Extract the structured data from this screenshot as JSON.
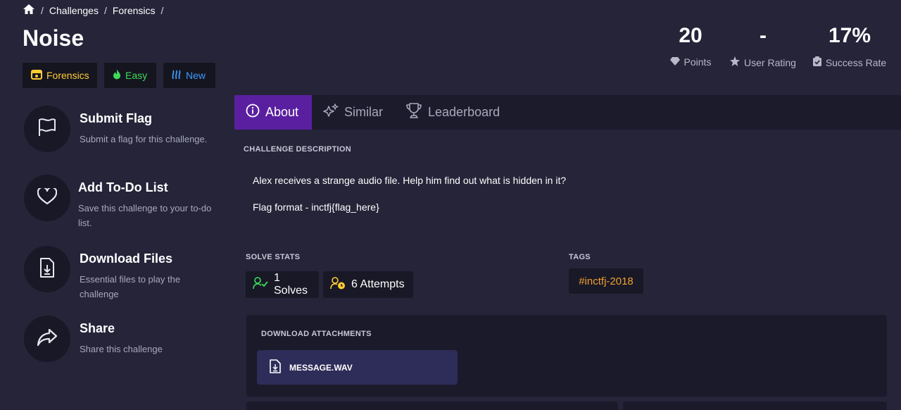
{
  "breadcrumb": {
    "items": [
      "Challenges",
      "Forensics"
    ],
    "separator": "/"
  },
  "challenge": {
    "title": "Noise"
  },
  "badges": {
    "category": "Forensics",
    "difficulty": "Easy",
    "status": "New"
  },
  "stats": {
    "points": {
      "value": "20",
      "label": "Points"
    },
    "rating": {
      "value": "-",
      "label": "User Rating"
    },
    "success": {
      "value": "17%",
      "label": "Success Rate"
    }
  },
  "sidebar": {
    "submit": {
      "title": "Submit Flag",
      "subtitle": "Submit a flag for this challenge."
    },
    "todo": {
      "title": "Add To-Do List",
      "subtitle": "Save this challenge to your to-do list."
    },
    "download": {
      "title": "Download Files",
      "subtitle": "Essential files to play the challenge"
    },
    "share": {
      "title": "Share",
      "subtitle": "Share this challenge"
    }
  },
  "tabs": {
    "about": "About",
    "similar": "Similar",
    "leaderboard": "Leaderboard"
  },
  "description": {
    "label": "CHALLENGE DESCRIPTION",
    "line1": "Alex receives a strange audio file. Help him find out what is hidden in it?",
    "line2": "Flag format - inctfj{flag_here}"
  },
  "solve_stats": {
    "label": "SOLVE STATS",
    "solves": "1 Solves",
    "attempts": "6 Attempts"
  },
  "tags": {
    "label": "TAGS",
    "items": [
      "#inctfj-2018"
    ]
  },
  "attachments": {
    "label": "DOWNLOAD ATTACHMENTS",
    "file": "MESSAGE.WAV"
  },
  "colors": {
    "background": "#252439",
    "accent_tab": "#5a1fa0",
    "forensics": "#ffcc33",
    "easy": "#3ddc5a",
    "new": "#3e9bff",
    "tag": "#f0a030"
  }
}
